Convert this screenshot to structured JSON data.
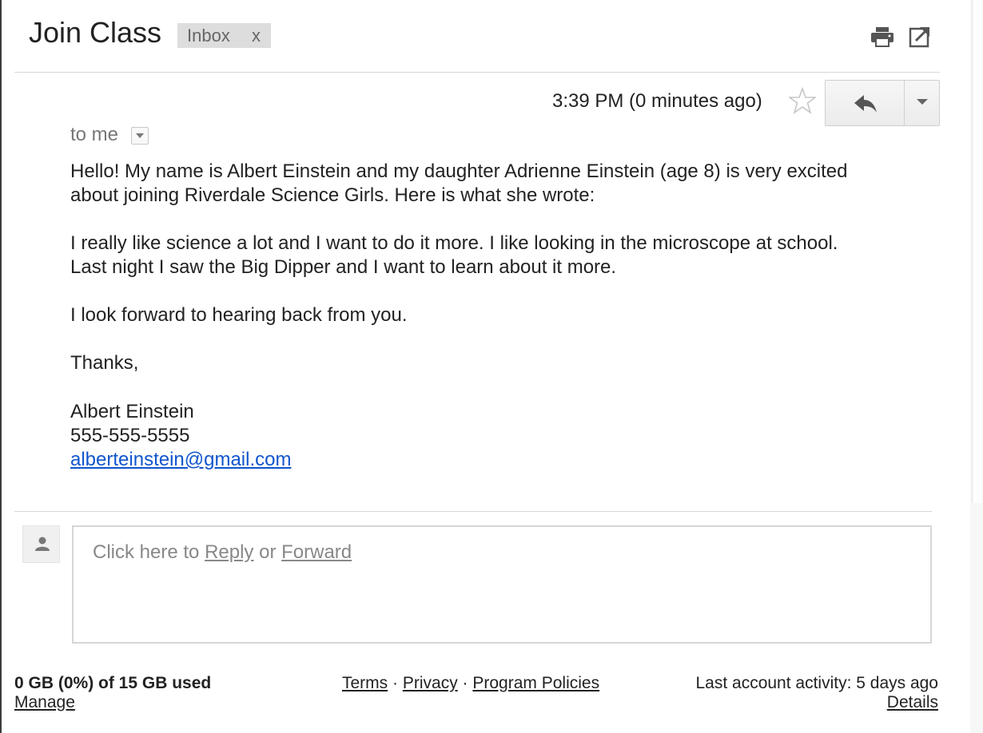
{
  "header": {
    "subject": "Join Class",
    "label": "Inbox",
    "label_remove": "x"
  },
  "message": {
    "timestamp": "3:39 PM (0 minutes ago)",
    "recipient": "to me",
    "body": [
      "Hello! My name is Albert Einstein and my daughter Adrienne Einstein (age 8) is very excited",
      "about joining Riverdale Science Girls. Here is what she wrote:",
      "I really like science a lot and I want to do it more. I like looking in the microscope at school.",
      "Last night I saw the Big Dipper and I want to learn about it more.",
      "I look forward to hearing back from you.",
      "Thanks,",
      "Albert Einstein",
      "555-555-5555"
    ],
    "email": "alberteinstein@gmail.com"
  },
  "reply_box": {
    "prefix": "Click here to ",
    "reply": "Reply",
    "or": " or ",
    "forward": "Forward"
  },
  "footer": {
    "storage": "0 GB (0%) of 15 GB used",
    "manage": "Manage",
    "terms": "Terms",
    "sep": " · ",
    "privacy": "Privacy",
    "program_policies": "Program Policies",
    "activity": "Last account activity: 5 days ago",
    "details": "Details"
  },
  "icons": {
    "print": "print-icon",
    "popout": "new-window-icon",
    "star": "star-icon",
    "reply": "reply-arrow-icon",
    "more": "dropdown-caret-icon",
    "avatar": "person-icon"
  },
  "colors": {
    "link": "#1155cc",
    "label_bg": "#dddddd",
    "muted_text": "#888888"
  }
}
